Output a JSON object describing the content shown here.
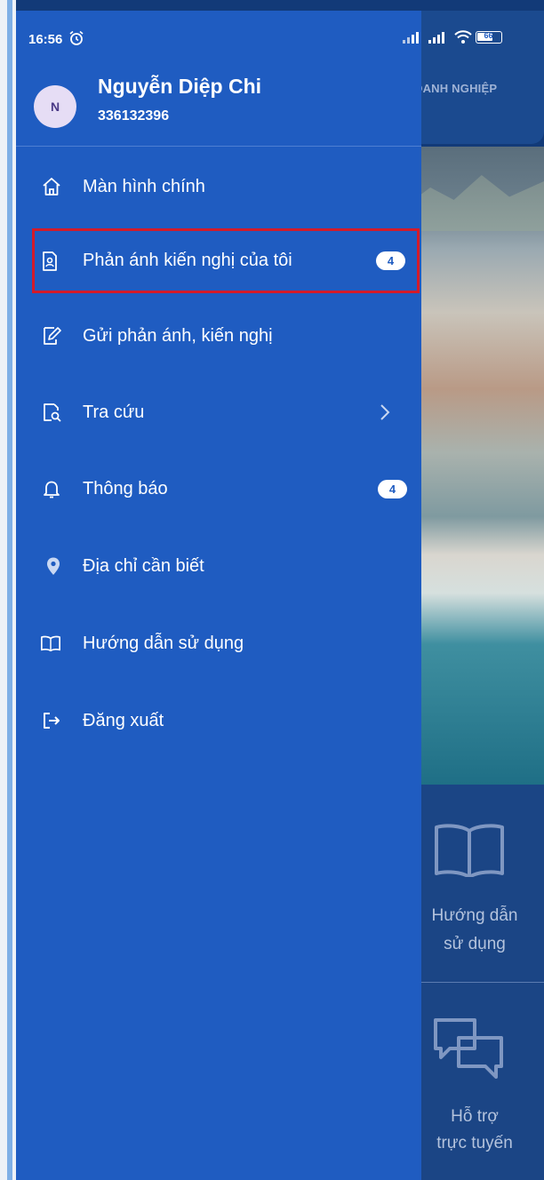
{
  "status_bar": {
    "time": "16:56",
    "battery": "66"
  },
  "user": {
    "initial": "N",
    "name": "Nguyễn Diệp Chi",
    "phone": "336132396"
  },
  "menu": {
    "items": [
      {
        "label": "Màn hình chính",
        "icon": "home-icon"
      },
      {
        "label": "Phản ánh kiến nghị của tôi",
        "icon": "document-user-icon",
        "badge": "4",
        "selected": true
      },
      {
        "label": "Gửi phản ánh, kiến nghị",
        "icon": "edit-document-icon"
      },
      {
        "label": "Tra cứu",
        "icon": "search-document-icon",
        "has_submenu": true
      },
      {
        "label": "Thông báo",
        "icon": "bell-icon",
        "badge": "4"
      },
      {
        "label": "Địa chỉ cần biết",
        "icon": "location-pin-icon"
      },
      {
        "label": "Hướng dẫn sử dụng",
        "icon": "book-icon"
      },
      {
        "label": "Đăng xuất",
        "icon": "logout-icon"
      }
    ]
  },
  "background_app": {
    "header_label": "DANH NGHIỆP",
    "tiles": [
      {
        "label_line1": "Hướng dẫn",
        "label_line2": "sử dụng",
        "icon": "book-icon"
      },
      {
        "label_line1": "Hỗ trợ",
        "label_line2": "trực tuyến",
        "icon": "chat-bubbles-icon"
      }
    ]
  },
  "colors": {
    "drawer": "#1f5cc1",
    "highlight": "#d31b2b",
    "badge_bg": "#ffffff"
  }
}
